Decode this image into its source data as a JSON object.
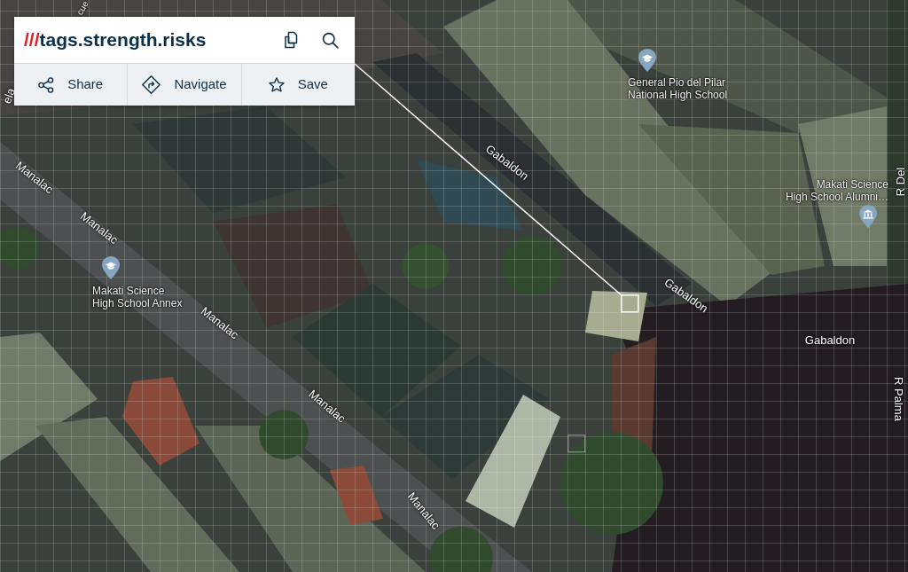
{
  "card": {
    "prefix": "///",
    "address": "tags.strength.risks",
    "actions": [
      {
        "kind": "share",
        "label": "Share"
      },
      {
        "kind": "navigate",
        "label": "Navigate"
      },
      {
        "kind": "save",
        "label": "Save"
      }
    ]
  },
  "map": {
    "places": [
      {
        "kind": "school",
        "lines": [
          "General Pio del Pilar",
          "National High School"
        ]
      },
      {
        "kind": "museum",
        "lines": [
          "Makati Science",
          "High School Alumni…"
        ]
      },
      {
        "kind": "school",
        "lines": [
          "Makati Science",
          "High School Annex"
        ]
      }
    ],
    "streets": [
      {
        "name": "cue"
      },
      {
        "name": "ela"
      },
      {
        "name": "Manalac"
      },
      {
        "name": "Manalac"
      },
      {
        "name": "Manalac"
      },
      {
        "name": "Manalac"
      },
      {
        "name": "Manalac"
      },
      {
        "name": "Gabaldon"
      },
      {
        "name": "Gabaldon"
      },
      {
        "name": "Gabaldon"
      },
      {
        "name": "R Del"
      },
      {
        "name": "R Palma"
      }
    ],
    "squares": [
      {
        "selected": true
      },
      {
        "selected": false
      }
    ]
  }
}
